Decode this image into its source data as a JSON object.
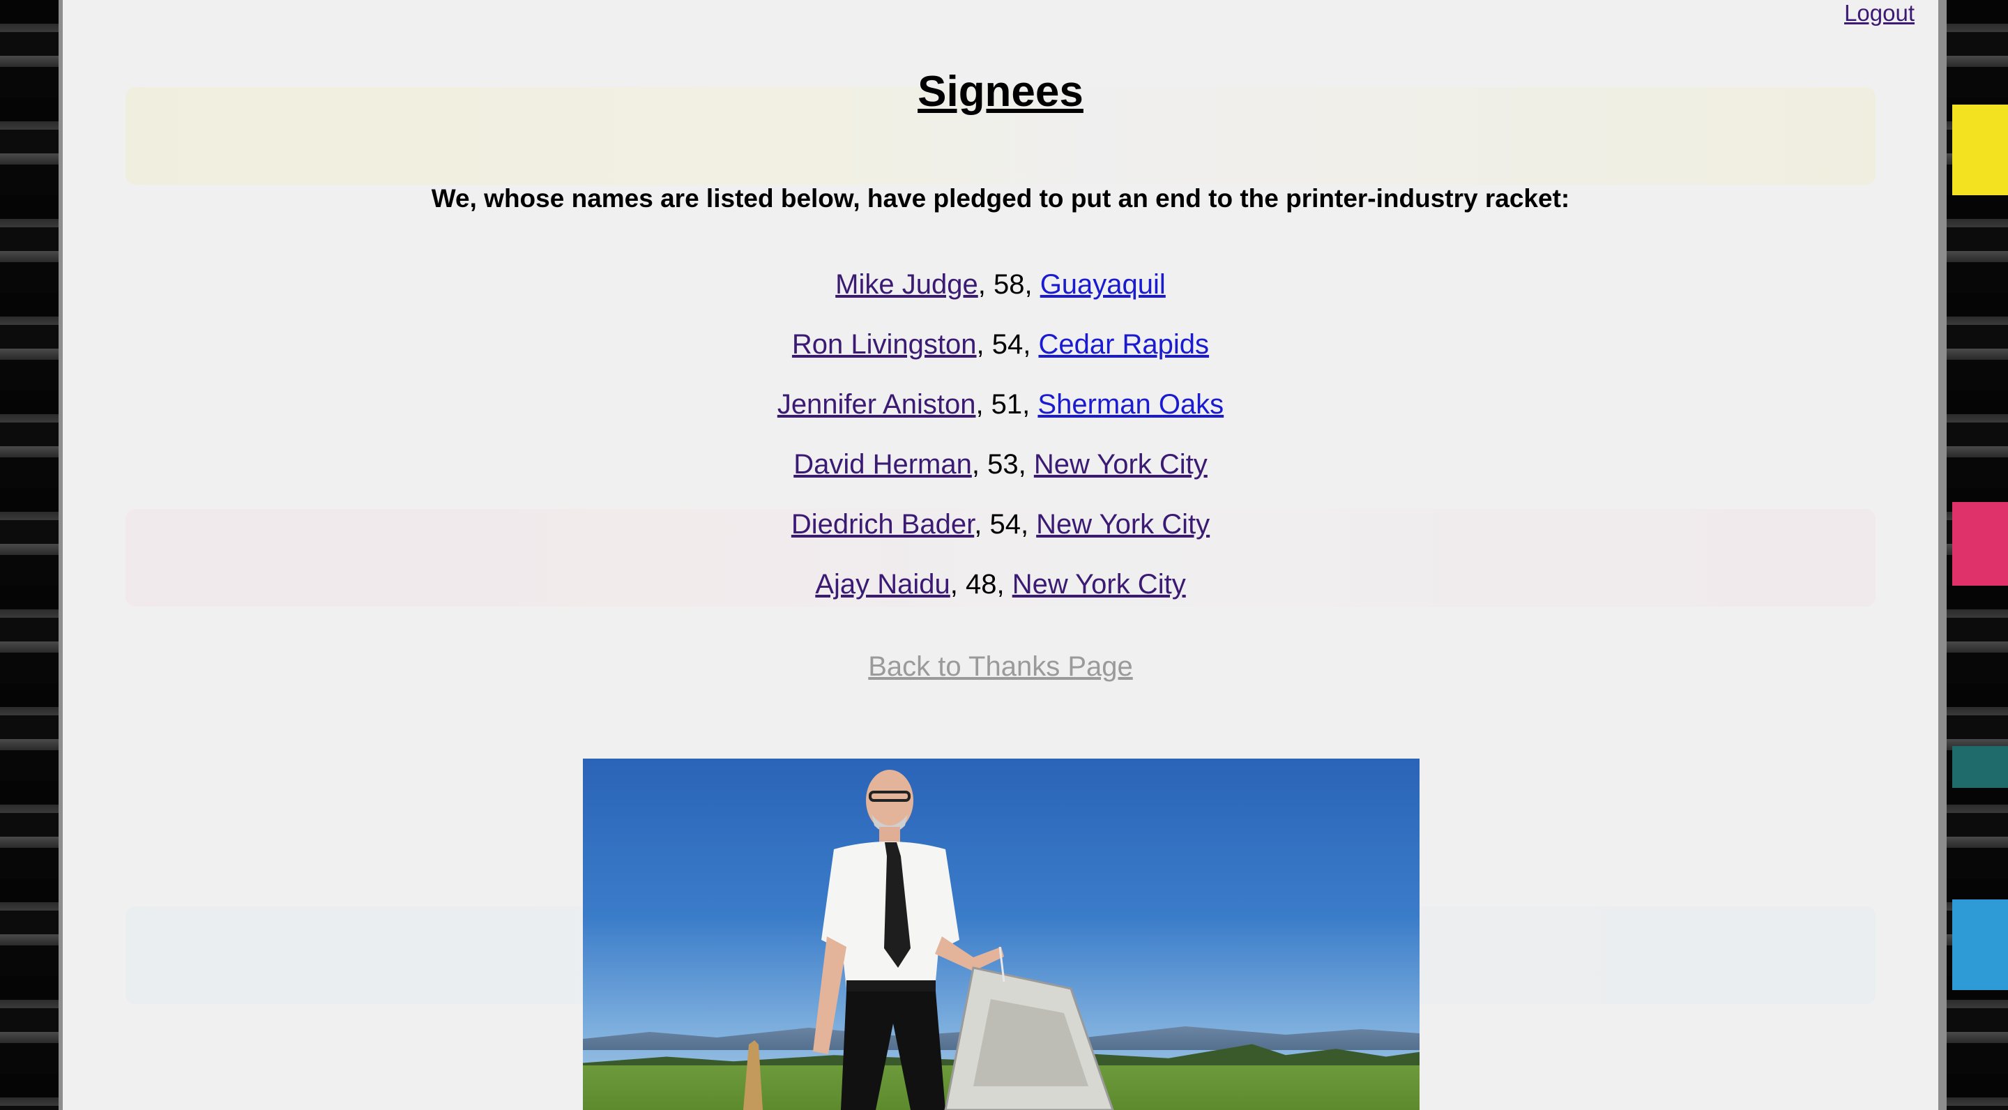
{
  "header": {
    "logout_label": "Logout"
  },
  "page": {
    "title": "Signees",
    "intro": "We, whose names are listed below, have pledged to put an end to the printer-industry racket:",
    "back_label": "Back to Thanks Page"
  },
  "signees": [
    {
      "name": "Mike Judge",
      "age": ", 58, ",
      "city": "Guayaquil",
      "city_visited": false
    },
    {
      "name": "Ron Livingston",
      "age": ", 54, ",
      "city": "Cedar Rapids",
      "city_visited": false
    },
    {
      "name": "Jennifer Aniston",
      "age": ", 51, ",
      "city": "Sherman Oaks",
      "city_visited": false
    },
    {
      "name": "David Herman",
      "age": ", 53, ",
      "city": "New York City",
      "city_visited": true
    },
    {
      "name": "Diedrich Bader",
      "age": ", 54, ",
      "city": "New York City",
      "city_visited": true
    },
    {
      "name": "Ajay Naidu",
      "age": ", 48, ",
      "city": "New York City",
      "city_visited": true
    }
  ],
  "colors": {
    "visited_link": "#3b1a74",
    "unvisited_link": "#1a1ad0",
    "disabled_link": "#9a9a9a",
    "page_background": "#f0f0f0"
  }
}
